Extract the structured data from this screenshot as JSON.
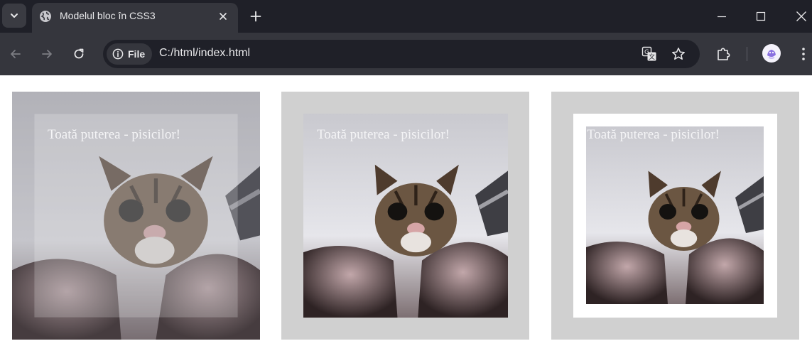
{
  "browser": {
    "tab_title": "Modelul bloc în CSS3",
    "site_chip_label": "File",
    "url": "C:/html/index.html"
  },
  "icons": {
    "tab_search": "chevron-down-icon",
    "favicon": "globe-icon",
    "tab_close": "close-icon",
    "new_tab": "plus-icon",
    "minimize": "minimize-icon",
    "maximize": "maximize-icon",
    "close_window": "close-icon",
    "back": "arrow-left-icon",
    "forward": "arrow-right-icon",
    "reload": "reload-icon",
    "site_info": "info-icon",
    "translate": "translate-icon",
    "bookmark": "star-icon",
    "extensions": "puzzle-icon",
    "menu": "kebab-menu-icon"
  },
  "colors": {
    "tab_strip": "#1f2028",
    "toolbar": "#35363d",
    "card_background": "#d0d0d0",
    "inner_border": "#ffffff"
  },
  "page": {
    "cards": [
      {
        "caption": "Toată puterea - pisicilor!"
      },
      {
        "caption": "Toată puterea - pisicilor!"
      },
      {
        "caption": "Toată puterea - pisicilor!"
      }
    ]
  }
}
